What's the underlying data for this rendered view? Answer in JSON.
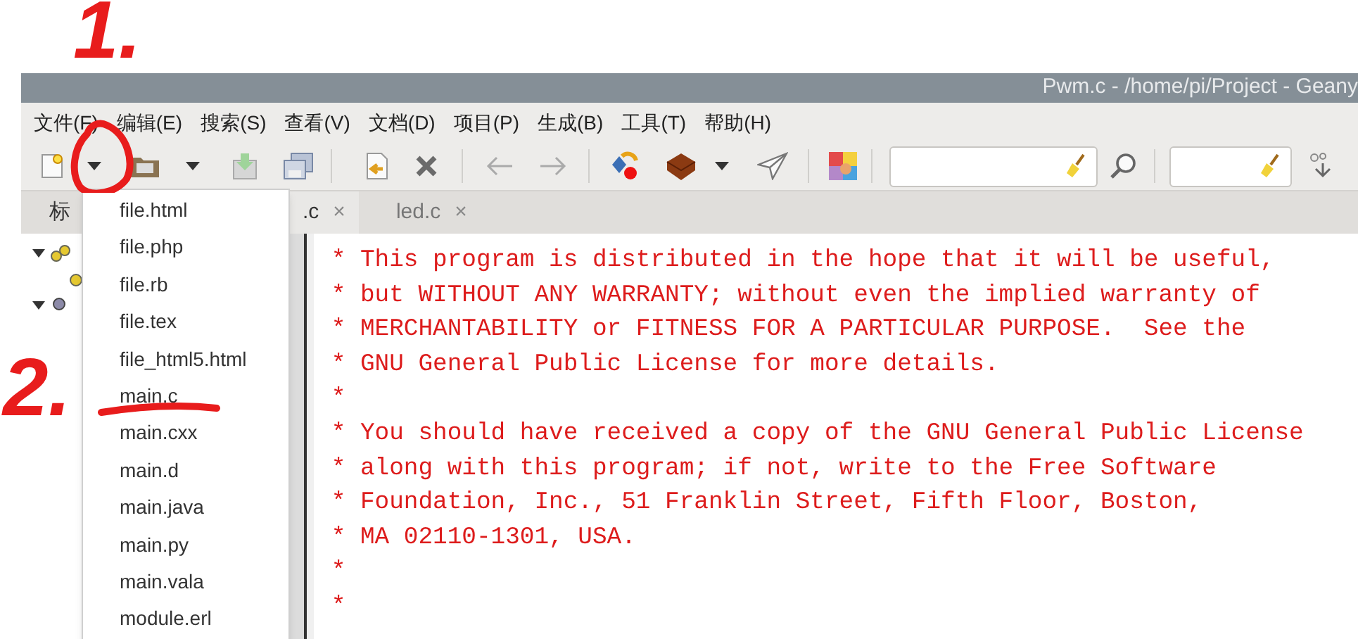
{
  "window": {
    "title": "Pwm.c - /home/pi/Project - Geany"
  },
  "menu_bar": [
    "文件(F)",
    "编辑(E)",
    "搜索(S)",
    "查看(V)",
    "文档(D)",
    "项目(P)",
    "生成(B)",
    "工具(T)",
    "帮助(H)"
  ],
  "sidebar": {
    "tabs": [
      "标"
    ]
  },
  "editor_tabs": [
    {
      "label": ".c",
      "close": "×"
    },
    {
      "label": "led.c",
      "close": "×"
    }
  ],
  "code_lines": [
    " * This program is distributed in the hope that it will be useful,",
    " * but WITHOUT ANY WARRANTY; without even the implied warranty of",
    " * MERCHANTABILITY or FITNESS FOR A PARTICULAR PURPOSE.  See the",
    " * GNU General Public License for more details.",
    " *",
    " * You should have received a copy of the GNU General Public License",
    " * along with this program; if not, write to the Free Software",
    " * Foundation, Inc., 51 Franklin Street, Fifth Floor, Boston,",
    " * MA 02110-1301, USA.",
    " *",
    " *"
  ],
  "template_menu": {
    "items": [
      "file.html",
      "file.php",
      "file.rb",
      "file.tex",
      "file_html5.html",
      "main.c",
      "main.cxx",
      "main.d",
      "main.java",
      "main.py",
      "main.vala",
      "module.erl"
    ]
  },
  "annotations": [
    {
      "text": "1."
    },
    {
      "text": "2."
    }
  ]
}
